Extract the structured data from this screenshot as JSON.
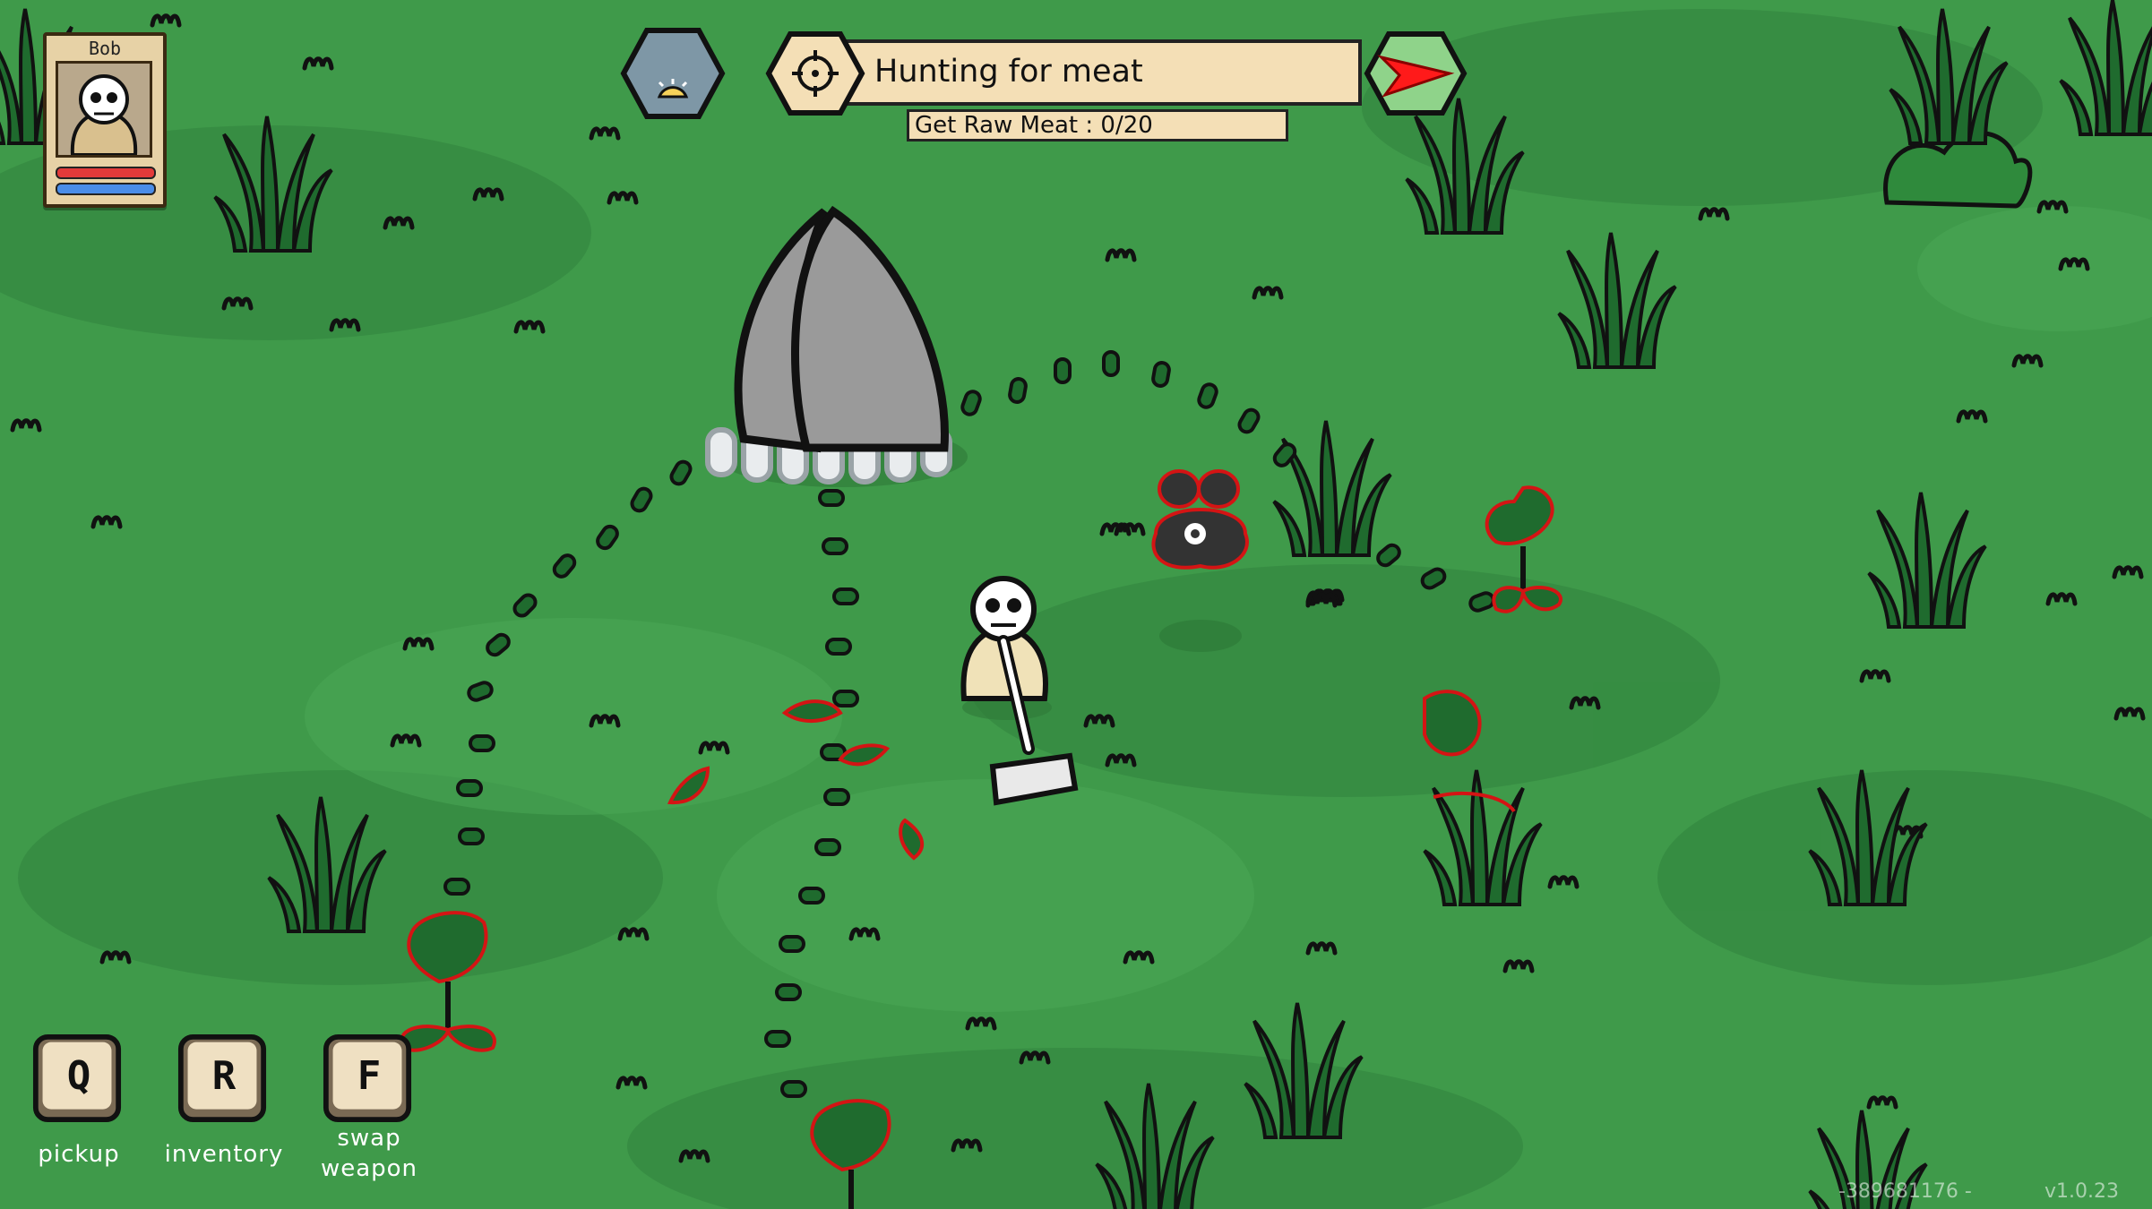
{
  "player": {
    "name": "Bob",
    "health": 1.0,
    "mana": 1.0
  },
  "quest": {
    "title": "Hunting for meat",
    "objective": "Get Raw Meat : 0/20"
  },
  "keybinds": [
    {
      "key": "Q",
      "label": "pickup"
    },
    {
      "key": "R",
      "label": "inventory"
    },
    {
      "key": "F",
      "label": "swap weapon"
    }
  ],
  "footer": {
    "seed": "-389681176 -",
    "version": "v1.0.23"
  },
  "colors": {
    "grass": "#3f9a4a",
    "grass_dark": "#2f7e3a",
    "quest_panel": "#f4dfb6",
    "compass_hex": "#8fd38a",
    "arrow": "#ff1a1a",
    "health": "#e23a3a",
    "mana": "#4a8de8",
    "enemy_outline": "#d41414"
  },
  "icons": [
    "skull-portrait-icon",
    "day-night-icon",
    "crosshair-icon",
    "compass-arrow-icon"
  ]
}
